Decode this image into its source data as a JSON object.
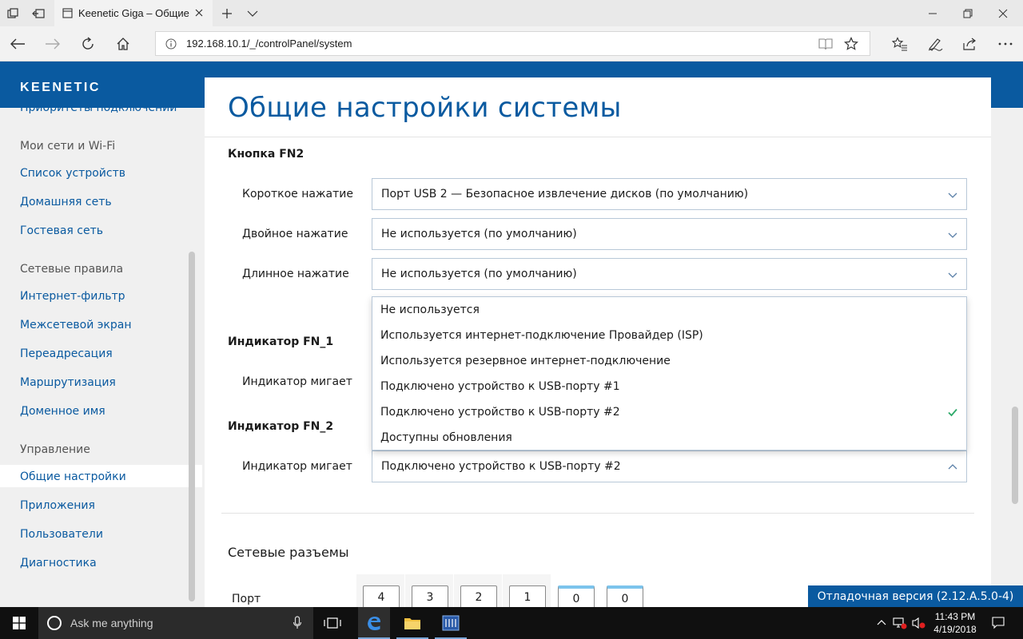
{
  "browser": {
    "tab_title": "Keenetic Giga – Общие",
    "url": "192.168.10.1/_/controlPanel/system"
  },
  "brand": "KEENETIC",
  "sidebar": {
    "partial_item": "Приоритеты подключений",
    "groups": [
      {
        "heading": "Мои сети и Wi-Fi",
        "items": [
          "Список устройств",
          "Домашняя сеть",
          "Гостевая сеть"
        ]
      },
      {
        "heading": "Сетевые правила",
        "items": [
          "Интернет-фильтр",
          "Межсетевой экран",
          "Переадресация",
          "Маршрутизация",
          "Доменное имя"
        ]
      },
      {
        "heading": "Управление",
        "items": [
          "Общие настройки",
          "Приложения",
          "Пользователи",
          "Диагностика"
        ]
      }
    ],
    "active_item": "Общие настройки"
  },
  "main": {
    "title": "Общие настройки системы",
    "fn2": {
      "title": "Кнопка FN2",
      "short_label": "Короткое нажатие",
      "short_value": "Порт USB 2 — Безопасное извлечение дисков (по умолчанию)",
      "double_label": "Двойное нажатие",
      "double_value": "Не используется (по умолчанию)",
      "long_label": "Длинное нажатие",
      "long_value": "Не используется (по умолчанию)"
    },
    "fn_1": {
      "title": "Индикатор FN_1",
      "blink_label": "Индикатор мигает"
    },
    "fn_2": {
      "title": "Индикатор FN_2",
      "blink_label": "Индикатор мигает",
      "blink_value": "Подключено устройство к USB-порту #2"
    },
    "dropdown_options": [
      "Не используется",
      "Используется интернет-подключение Провайдер (ISP)",
      "Используется резервное интернет-подключение",
      "Подключено устройство к USB-порту #1",
      "Подключено устройство к USB-порту #2",
      "Доступны обновления"
    ],
    "dropdown_selected_index": 4,
    "ports": {
      "title": "Сетевые разъемы",
      "label": "Порт",
      "numbers": [
        "4",
        "3",
        "2",
        "1",
        "0",
        "0"
      ]
    },
    "debug_badge": "Отладочная версия (2.12.A.5.0-4)"
  },
  "taskbar": {
    "search_placeholder": "Ask me anything",
    "time": "11:43 PM",
    "date": "4/19/2018"
  },
  "colors": {
    "brand": "#0a5aa0",
    "check": "#2eaa6a",
    "port_active": "#7cc4ec"
  }
}
